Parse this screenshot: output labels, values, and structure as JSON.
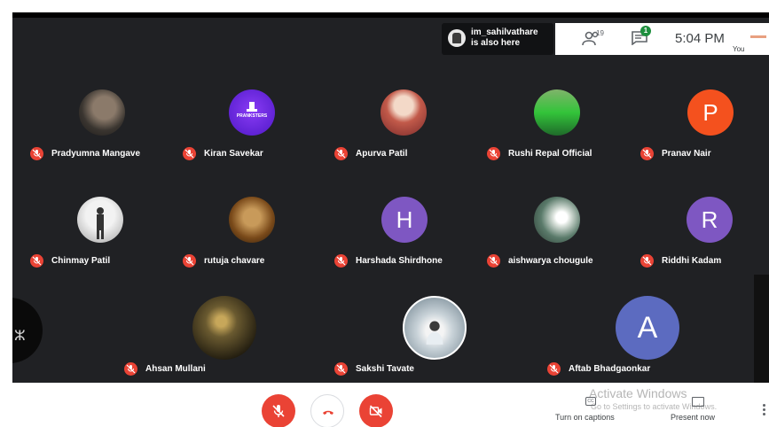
{
  "top": {
    "also_here_text": "im_sahilvathare\nis also here",
    "people_count": "19",
    "chat_badge": "1",
    "clock": "5:04 PM",
    "you_label": "You"
  },
  "participants": [
    {
      "name": "Pradyumna Mangave",
      "avatar": "photo",
      "color": "#6d5a4a"
    },
    {
      "name": "Kiran Savekar",
      "avatar": "logo",
      "color": "#7b2ff7"
    },
    {
      "name": "Apurva Patil",
      "avatar": "photo",
      "color": "#c98a7a"
    },
    {
      "name": "Rushi Repal Official",
      "avatar": "photo",
      "color": "#3f8f3a"
    },
    {
      "name": "Pranav Nair",
      "avatar": "letter",
      "letter": "P",
      "color": "#f4511e"
    },
    {
      "name": "Chinmay Patil",
      "avatar": "photo",
      "color": "#cfcfcf"
    },
    {
      "name": "rutuja chavare",
      "avatar": "photo",
      "color": "#8a5a2a"
    },
    {
      "name": "Harshada Shirdhone",
      "avatar": "letter",
      "letter": "H",
      "color": "#7e57c2"
    },
    {
      "name": "aishwarya chougule",
      "avatar": "photo",
      "color": "#5a7a6a"
    },
    {
      "name": "Riddhi Kadam",
      "avatar": "letter",
      "letter": "R",
      "color": "#7e57c2"
    },
    {
      "name": "Ahsan Mullani",
      "avatar": "photo",
      "color": "#3a3220"
    },
    {
      "name": "Sakshi Tavate",
      "avatar": "photo",
      "color": "#b8c4cc"
    },
    {
      "name": "Aftab Bhadgaonkar",
      "avatar": "letter",
      "letter": "A",
      "color": "#5c6bc0"
    }
  ],
  "controls": {
    "captions_label": "Turn on captions",
    "present_label": "Present now",
    "captions_icon_text": "CC"
  },
  "watermark": {
    "line1": "Activate Windows",
    "line2": "Go to Settings to activate Windows."
  },
  "kiran_logo_text": "PRANKSTERS"
}
